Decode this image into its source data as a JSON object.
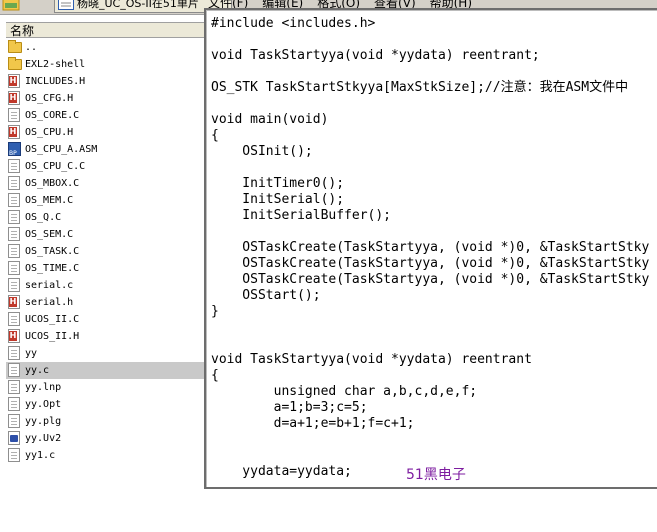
{
  "titlebar": {
    "tab_label": "杨晓_UC_OS-II在51单片"
  },
  "menu": {
    "items": [
      "文件(F)",
      "编辑(E)",
      "格式(O)",
      "查看(V)",
      "帮助(H)"
    ]
  },
  "file_panel": {
    "header": "名称",
    "items": [
      {
        "name": "..",
        "icon": "folder-icon"
      },
      {
        "name": "EXL2-shell",
        "icon": "folder-icon"
      },
      {
        "name": "INCLUDES.H",
        "icon": "header-file-icon"
      },
      {
        "name": "OS_CFG.H",
        "icon": "header-file-icon"
      },
      {
        "name": "OS_CORE.C",
        "icon": "text-file-icon"
      },
      {
        "name": "OS_CPU.H",
        "icon": "header-file-icon"
      },
      {
        "name": "OS_CPU_A.ASM",
        "icon": "asm-file-icon"
      },
      {
        "name": "OS_CPU_C.C",
        "icon": "text-file-icon"
      },
      {
        "name": "OS_MBOX.C",
        "icon": "text-file-icon"
      },
      {
        "name": "OS_MEM.C",
        "icon": "text-file-icon"
      },
      {
        "name": "OS_Q.C",
        "icon": "text-file-icon"
      },
      {
        "name": "OS_SEM.C",
        "icon": "text-file-icon"
      },
      {
        "name": "OS_TASK.C",
        "icon": "text-file-icon"
      },
      {
        "name": "OS_TIME.C",
        "icon": "text-file-icon"
      },
      {
        "name": "serial.c",
        "icon": "text-file-icon"
      },
      {
        "name": "serial.h",
        "icon": "header-file-icon"
      },
      {
        "name": "UCOS_II.C",
        "icon": "text-file-icon"
      },
      {
        "name": "UCOS_II.H",
        "icon": "header-file-icon"
      },
      {
        "name": "yy",
        "icon": "text-file-icon"
      },
      {
        "name": "yy.c",
        "icon": "text-file-icon",
        "selected": true
      },
      {
        "name": "yy.lnp",
        "icon": "text-file-icon"
      },
      {
        "name": "yy.Opt",
        "icon": "text-file-icon"
      },
      {
        "name": "yy.plg",
        "icon": "text-file-icon"
      },
      {
        "name": "yy.Uv2",
        "icon": "uvision-file-icon"
      },
      {
        "name": "yy1.c",
        "icon": "text-file-icon"
      }
    ]
  },
  "editor": {
    "lines": [
      "#include <includes.h>",
      "",
      "void TaskStartyya(void *yydata) reentrant;",
      "",
      "OS_STK TaskStartStkyya[MaxStkSize];//注意：我在ASM文件中",
      "",
      "void main(void)",
      "{",
      "    OSInit();",
      "",
      "    InitTimer0();",
      "    InitSerial();",
      "    InitSerialBuffer();",
      "",
      "    OSTaskCreate(TaskStartyya, (void *)0, &TaskStartStky",
      "    OSTaskCreate(TaskStartyya, (void *)0, &TaskStartStky",
      "    OSTaskCreate(TaskStartyya, (void *)0, &TaskStartStky",
      "    OSStart();",
      "}",
      "",
      "",
      "void TaskStartyya(void *yydata) reentrant",
      "{",
      "        unsigned char a,b,c,d,e,f;",
      "        a=1;b=3;c=5;",
      "        d=a+1;e=b+1;f=c+1;",
      "",
      "",
      "    yydata=yydata;"
    ],
    "watermark": "51黑电子"
  }
}
